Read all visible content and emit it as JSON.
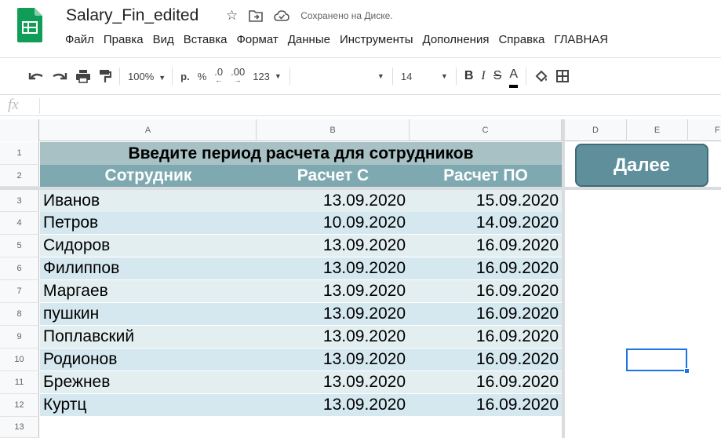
{
  "app": {
    "title": "Salary_Fin_edited",
    "save_status": "Сохранено на Диске.",
    "brand_color": "#0f9d58"
  },
  "menu": [
    "Файл",
    "Правка",
    "Вид",
    "Вставка",
    "Формат",
    "Данные",
    "Инструменты",
    "Дополнения",
    "Справка",
    "ГЛАВНАЯ"
  ],
  "toolbar": {
    "zoom": "100%",
    "currency": "р.",
    "percent": "%",
    "dec_less": ".0",
    "dec_more": ".00",
    "format_123": "123",
    "font_size": "14",
    "bold": "B",
    "italic": "I",
    "strike": "S",
    "text_color": "A"
  },
  "formula_bar": {
    "fx": "fx",
    "value": ""
  },
  "columns": [
    "A",
    "B",
    "C",
    "D",
    "E",
    "F"
  ],
  "rows": [
    "1",
    "2",
    "3",
    "4",
    "5",
    "6",
    "7",
    "8",
    "9",
    "10",
    "11",
    "12",
    "13"
  ],
  "sheet": {
    "banner": "Введите период расчета для сотрудников",
    "headers": [
      "Сотрудник",
      "Расчет С",
      "Расчет ПО"
    ],
    "records": [
      {
        "name": "Иванов",
        "from": "13.09.2020",
        "to": "15.09.2020"
      },
      {
        "name": "Петров",
        "from": "10.09.2020",
        "to": "14.09.2020"
      },
      {
        "name": "Сидоров",
        "from": "13.09.2020",
        "to": "16.09.2020"
      },
      {
        "name": "Филиппов",
        "from": "13.09.2020",
        "to": "16.09.2020"
      },
      {
        "name": "Маргаев",
        "from": "13.09.2020",
        "to": "16.09.2020"
      },
      {
        "name": "пушкин",
        "from": "13.09.2020",
        "to": "16.09.2020"
      },
      {
        "name": "Поплавский",
        "from": "13.09.2020",
        "to": "16.09.2020"
      },
      {
        "name": "Родионов",
        "from": "13.09.2020",
        "to": "16.09.2020"
      },
      {
        "name": "Брежнев",
        "from": "13.09.2020",
        "to": "16.09.2020"
      },
      {
        "name": "Куртц",
        "from": "13.09.2020",
        "to": "16.09.2020"
      }
    ],
    "row_colors": [
      "#e3eef1",
      "#d5e8f0"
    ]
  },
  "next_button": {
    "label": "Далее"
  }
}
